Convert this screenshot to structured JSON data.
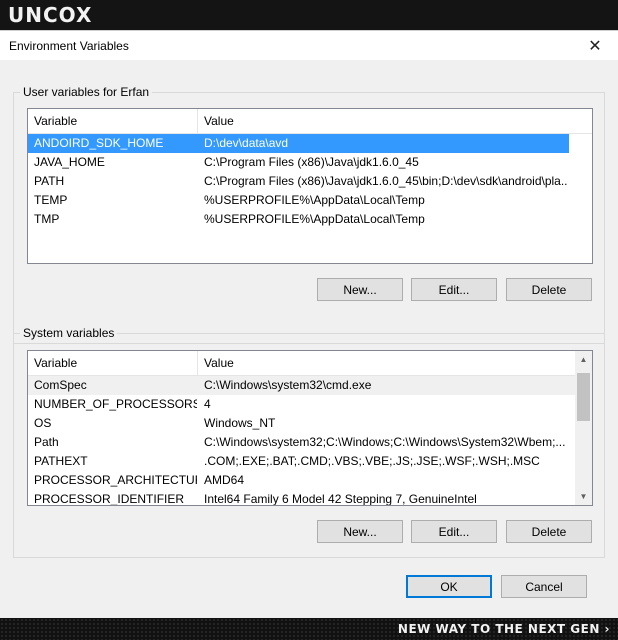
{
  "branding": {
    "logo": "UNCOX",
    "tagline": "NEW WAY TO THE NEXT GEN ›"
  },
  "dialog": {
    "title": "Environment Variables",
    "close_glyph": "✕"
  },
  "user_vars": {
    "group_label": "User variables for Erfan",
    "columns": [
      "Variable",
      "Value"
    ],
    "rows": [
      {
        "variable": "ANDOIRD_SDK_HOME",
        "value": "D:\\dev\\data\\avd",
        "selected": true
      },
      {
        "variable": "JAVA_HOME",
        "value": "C:\\Program Files (x86)\\Java\\jdk1.6.0_45"
      },
      {
        "variable": "PATH",
        "value": "C:\\Program Files (x86)\\Java\\jdk1.6.0_45\\bin;D:\\dev\\sdk\\android\\pla..."
      },
      {
        "variable": "TEMP",
        "value": "%USERPROFILE%\\AppData\\Local\\Temp"
      },
      {
        "variable": "TMP",
        "value": "%USERPROFILE%\\AppData\\Local\\Temp"
      }
    ],
    "buttons": {
      "new": "New...",
      "edit": "Edit...",
      "delete": "Delete"
    }
  },
  "system_vars": {
    "group_label": "System variables",
    "columns": [
      "Variable",
      "Value"
    ],
    "rows": [
      {
        "variable": "ComSpec",
        "value": "C:\\Windows\\system32\\cmd.exe",
        "hover": true
      },
      {
        "variable": "NUMBER_OF_PROCESSORS",
        "value": "4"
      },
      {
        "variable": "OS",
        "value": "Windows_NT"
      },
      {
        "variable": "Path",
        "value": "C:\\Windows\\system32;C:\\Windows;C:\\Windows\\System32\\Wbem;..."
      },
      {
        "variable": "PATHEXT",
        "value": ".COM;.EXE;.BAT;.CMD;.VBS;.VBE;.JS;.JSE;.WSF;.WSH;.MSC"
      },
      {
        "variable": "PROCESSOR_ARCHITECTURE",
        "value": "AMD64"
      },
      {
        "variable": "PROCESSOR_IDENTIFIER",
        "value": "Intel64 Family 6 Model 42 Stepping 7, GenuineIntel"
      }
    ],
    "buttons": {
      "new": "New...",
      "edit": "Edit...",
      "delete": "Delete"
    },
    "scrollbar": {
      "up_glyph": "▲",
      "down_glyph": "▼"
    }
  },
  "footer": {
    "ok": "OK",
    "cancel": "Cancel"
  },
  "colors": {
    "selection": "#3399ff",
    "default_button_border": "#0078d7"
  }
}
